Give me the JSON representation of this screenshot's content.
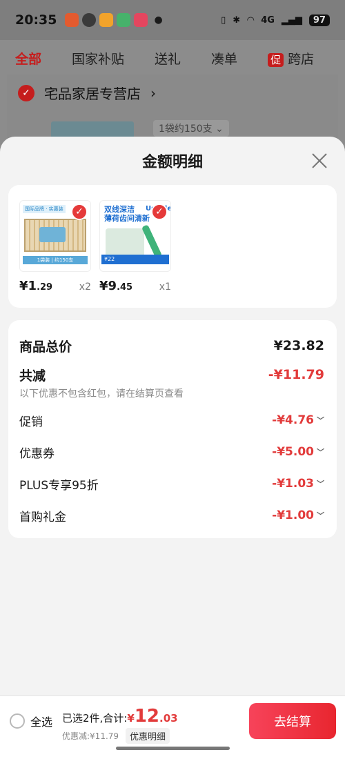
{
  "status_bar": {
    "time": "20:35",
    "network": "4G",
    "battery": "97",
    "app_colors": [
      "#e35b2f",
      "#3a3a3a",
      "#f2a32b",
      "#47b26b",
      "#e4465f"
    ]
  },
  "background": {
    "tabs": [
      "全部",
      "国家补贴",
      "送礼",
      "凑单",
      "跨店"
    ],
    "promo_badge": "促",
    "store_name": "宅品家居专营店",
    "store_chevron": "›",
    "variant": "1袋约150支 ⌄"
  },
  "sheet": {
    "title": "金额明细",
    "products": [
      {
        "price_symbol": "¥",
        "price_int": "1",
        "price_dec": ".29",
        "qty": "x2",
        "img_top": "国际品牌 · 实惠装",
        "img_bottom": "1袋装 | 约150支"
      },
      {
        "price_symbol": "¥",
        "price_int": "9",
        "price_dec": ".45",
        "qty": "x1",
        "img_text": "双线深洁\n薄荷齿间清新",
        "img_brand": "Usmile",
        "img_bar": "¥22"
      }
    ],
    "summary": {
      "total_label": "商品总价",
      "total_value": "¥23.82",
      "reduce_label": "共减",
      "reduce_value": "-¥11.79",
      "reduce_note": "以下优惠不包含红包，请在结算页查看",
      "discounts": [
        {
          "label": "促销",
          "value": "-¥4.76"
        },
        {
          "label": "优惠券",
          "value": "-¥5.00"
        },
        {
          "label": "PLUS专享95折",
          "value": "-¥1.03"
        },
        {
          "label": "首购礼金",
          "value": "-¥1.00"
        }
      ]
    }
  },
  "bottom_bar": {
    "select_all": "全选",
    "selected_text": "已选2件,合计:",
    "currency": "¥",
    "total_int": "12",
    "total_dec": ".03",
    "saved_text": "优惠减:¥11.79",
    "detail_label": "优惠明细",
    "checkout_label": "去结算"
  },
  "colors": {
    "accent_red": "#e23b3b",
    "checkout_gradient": [
      "#f7435a",
      "#e8262f"
    ]
  }
}
